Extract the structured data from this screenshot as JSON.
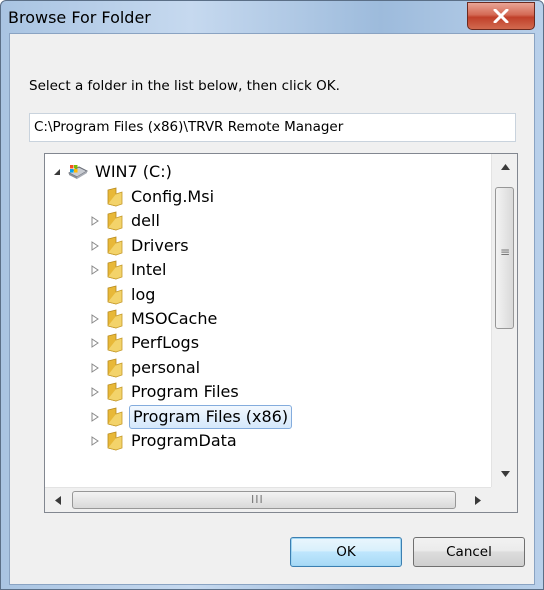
{
  "window": {
    "title": "Browse For Folder",
    "close_glyph": "X"
  },
  "dialog": {
    "instruction": "Select a folder in the list below, then click OK.",
    "path_value": "C:\\Program Files (x86)\\TRVR Remote Manager"
  },
  "tree": {
    "root": {
      "label": "WIN7 (C:)",
      "icon": "drive-icon",
      "expanded": true
    },
    "items": [
      {
        "label": "Config.Msi",
        "expandable": false,
        "selected": false
      },
      {
        "label": "dell",
        "expandable": true,
        "selected": false
      },
      {
        "label": "Drivers",
        "expandable": true,
        "selected": false
      },
      {
        "label": "Intel",
        "expandable": true,
        "selected": false
      },
      {
        "label": "log",
        "expandable": false,
        "selected": false
      },
      {
        "label": "MSOCache",
        "expandable": true,
        "selected": false
      },
      {
        "label": "PerfLogs",
        "expandable": true,
        "selected": false
      },
      {
        "label": "personal",
        "expandable": true,
        "selected": false
      },
      {
        "label": "Program Files",
        "expandable": true,
        "selected": false
      },
      {
        "label": "Program Files (x86)",
        "expandable": true,
        "selected": true
      },
      {
        "label": "ProgramData",
        "expandable": true,
        "selected": false
      }
    ],
    "hscroll_grip": "III",
    "vscroll_grip": "≡"
  },
  "buttons": {
    "ok": "OK",
    "cancel": "Cancel"
  },
  "colors": {
    "folder": "#e8b838",
    "selection_border": "#84acdd",
    "close_button": "#c7432b"
  }
}
